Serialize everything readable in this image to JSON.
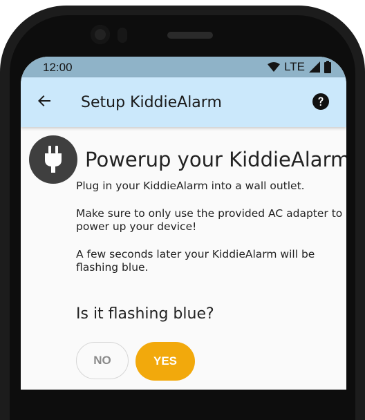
{
  "status_bar": {
    "time": "12:00",
    "network": "LTE",
    "icons": [
      "wifi-icon",
      "signal-icon",
      "battery-icon"
    ]
  },
  "app_bar": {
    "back_icon": "arrow-back-icon",
    "title": "Setup KiddieAlarm",
    "help_icon": "help-circle-icon",
    "background": "#cbe8fb"
  },
  "step": {
    "icon": "power-plug-icon",
    "heading": "Powerup your KiddieAlarm",
    "paragraphs": [
      "Plug in your KiddieAlarm into a wall outlet.",
      "Make sure to only use the provided AC adapter to power up your device!",
      "A few seconds later your KiddieAlarm will be flashing blue."
    ],
    "question": "Is it flashing blue?"
  },
  "buttons": {
    "no_label": "NO",
    "yes_label": "YES",
    "yes_color": "#f2a90c"
  }
}
